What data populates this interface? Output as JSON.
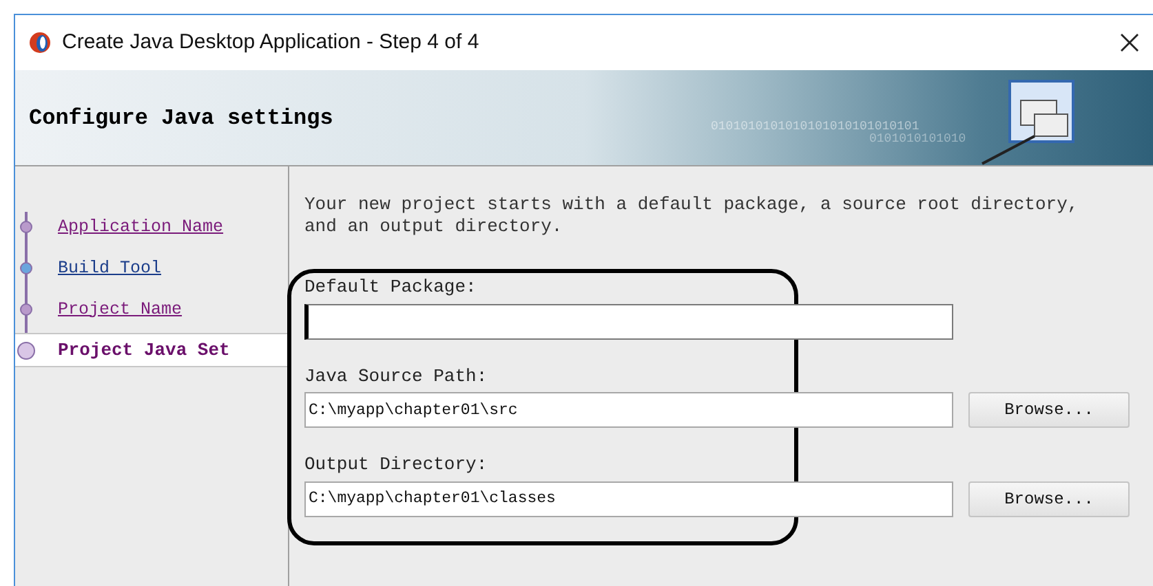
{
  "window": {
    "title": "Create Java Desktop Application - Step 4 of 4"
  },
  "header": {
    "title": "Configure Java settings",
    "banner_text": "0101010101010101010101010101",
    "banner_text_2": "0101010101010"
  },
  "steps": [
    {
      "label": "Application Name",
      "selected": false
    },
    {
      "label": "Build Tool",
      "selected": false
    },
    {
      "label": "Project Name",
      "selected": false
    },
    {
      "label": "Project Java Set",
      "selected": true
    }
  ],
  "intro": "Your new project starts with a default package, a source root directory, and an output directory.",
  "fields": [
    {
      "label": "Default Package:",
      "focused": true
    },
    {
      "label": "Java Source Path:",
      "value": "C:\\myapp\\chapter01\\src",
      "focused": false,
      "button": "Browse..."
    },
    {
      "label": "Output Directory:",
      "value": "C:\\myapp\\chapter01\\classes",
      "focused": false,
      "button": "Browse..."
    }
  ]
}
